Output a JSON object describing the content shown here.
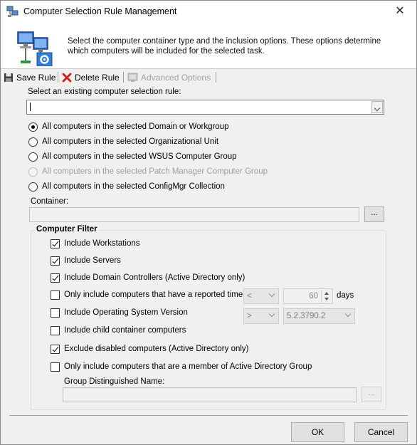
{
  "window": {
    "title": "Computer Selection Rule Management",
    "close_glyph": "✕",
    "title_icon": "network-computers-icon"
  },
  "header": {
    "description": "Select the computer container type and the inclusion options. These options determine which computers will be included for the selected task.",
    "icon": "computers-settings-icon"
  },
  "toolbar": {
    "save_label": "Save Rule",
    "delete_label": "Delete Rule",
    "advanced_label": "Advanced Options"
  },
  "rule_select": {
    "label": "Select an existing computer selection rule:",
    "value": ""
  },
  "container_types": [
    {
      "label": "All computers in the selected Domain or Workgroup",
      "checked": true,
      "enabled": true
    },
    {
      "label": "All computers in the selected Organizational Unit",
      "checked": false,
      "enabled": true
    },
    {
      "label": "All computers in the selected WSUS Computer Group",
      "checked": false,
      "enabled": true
    },
    {
      "label": "All computers in the selected Patch Manager Computer Group",
      "checked": false,
      "enabled": false
    },
    {
      "label": "All computers in the selected ConfigMgr Collection",
      "checked": false,
      "enabled": true
    }
  ],
  "container": {
    "label": "Container:",
    "value": "",
    "browse_label": "..."
  },
  "computer_filter": {
    "title": "Computer Filter",
    "include_workstations": {
      "label": "Include Workstations",
      "checked": true
    },
    "include_servers": {
      "label": "Include Servers",
      "checked": true
    },
    "include_domain_controllers": {
      "label": "Include Domain Controllers (Active Directory only)",
      "checked": true
    },
    "reported_time": {
      "label": "Only include computers that have a reported time",
      "checked": false,
      "operator": "<",
      "days_value": "60",
      "days_label": "days"
    },
    "os_version": {
      "label": "Include Operating System Version",
      "checked": false,
      "operator": ">",
      "version": "5.2.3790.2"
    },
    "child_containers": {
      "label": "Include child container computers",
      "checked": false
    },
    "exclude_disabled": {
      "label": "Exclude disabled computers (Active Directory only)",
      "checked": true
    },
    "ad_group": {
      "label": "Only include computers that are a member of Active Directory Group",
      "checked": false
    },
    "group_dn": {
      "label": "Group Distinguished Name:",
      "value": "",
      "browse_label": "..."
    }
  },
  "buttons": {
    "ok": "OK",
    "cancel": "Cancel"
  }
}
